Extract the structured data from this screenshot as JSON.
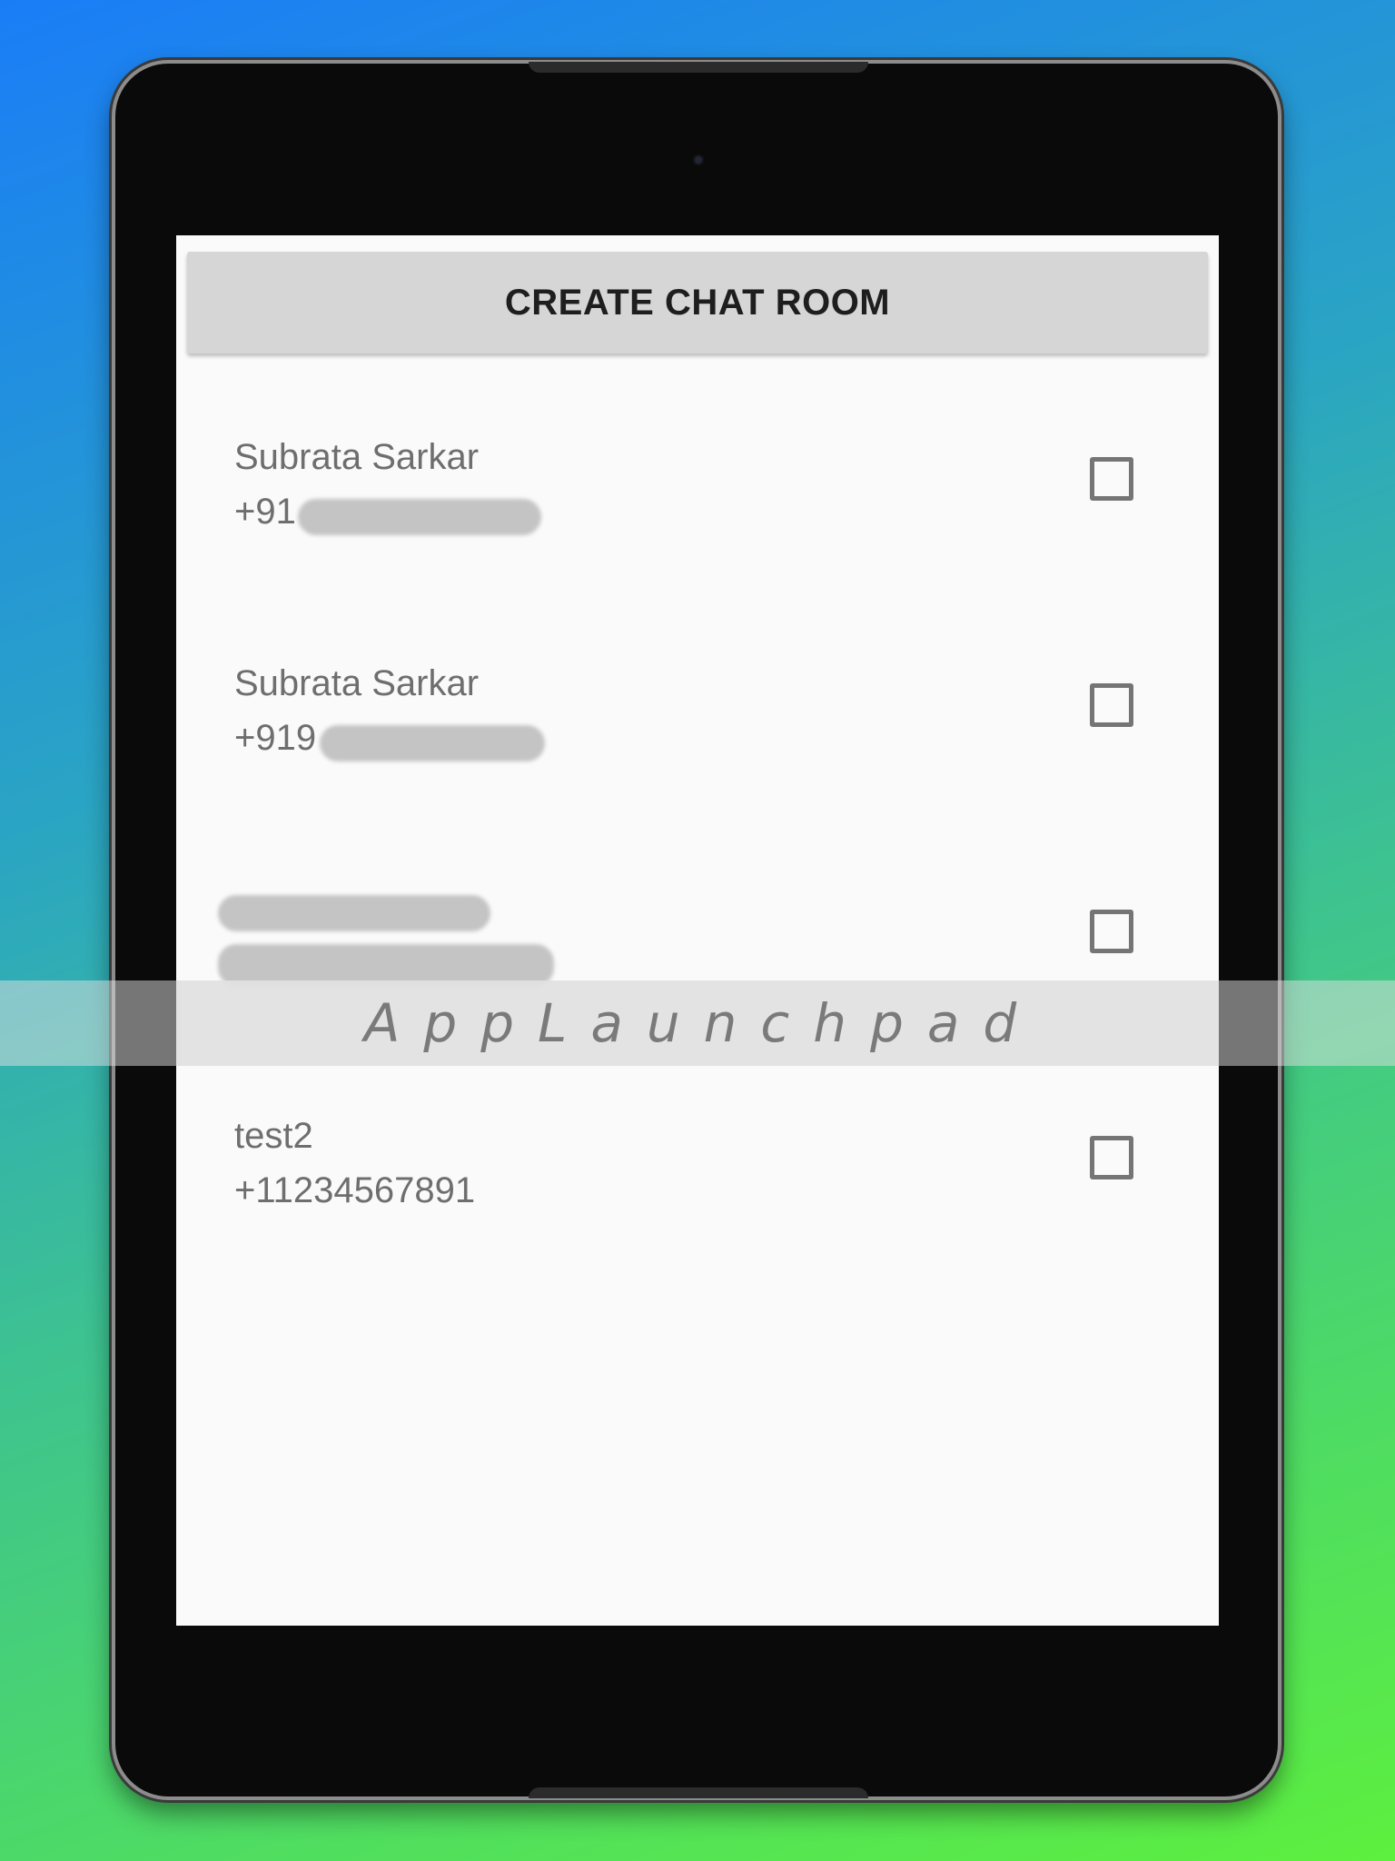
{
  "create_button": {
    "label": "CREATE CHAT ROOM"
  },
  "contacts": [
    {
      "name": "Subrata Sarkar",
      "phone": "+91",
      "phone_redacted": true,
      "name_redacted": false,
      "checked": false
    },
    {
      "name": "Subrata Sarkar",
      "phone": "+919",
      "phone_redacted": true,
      "name_redacted": false,
      "checked": false
    },
    {
      "name": "",
      "phone": "",
      "phone_redacted": true,
      "name_redacted": true,
      "checked": false
    },
    {
      "name": "test2",
      "phone": "+11234567891",
      "phone_redacted": false,
      "name_redacted": false,
      "checked": false
    }
  ],
  "watermark": {
    "text": "AppLaunchpad"
  },
  "colors": {
    "background_gradient_start": "#1a7df7",
    "background_gradient_end": "#5df03e",
    "device_body": "#0a0a0a",
    "screen_background": "#fafafa",
    "button_background": "#d6d6d6",
    "text_secondary": "#6e6e6e",
    "checkbox_border": "#757575"
  }
}
